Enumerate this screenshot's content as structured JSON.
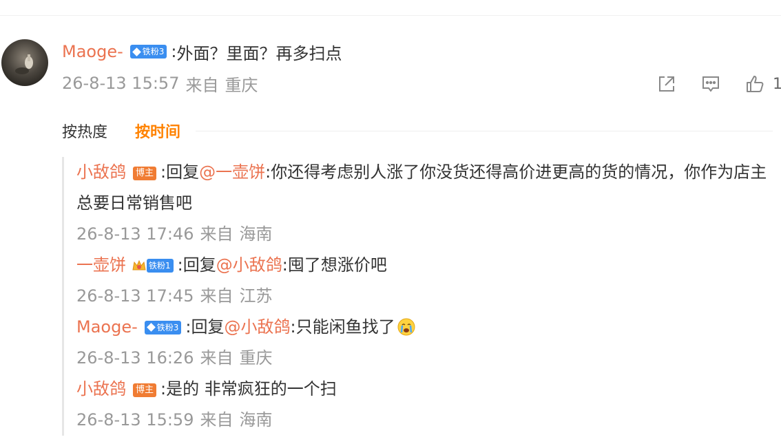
{
  "comment": {
    "username": "Maoge-",
    "fan_badge": "铁粉3",
    "text": "外面？里面？再多扫点",
    "date": "26-8-13 15:57",
    "from": "来自",
    "location": "重庆",
    "like_count": "1"
  },
  "sort": {
    "heat": "按热度",
    "time": "按时间"
  },
  "replies": [
    {
      "username": "小敌鸽",
      "badge": "博主",
      "reply_prefix": "回复",
      "mention": "@一壶饼",
      "text": "你还得考虑别人涨了你没货还得高价进更高的货的情况，你作为店主总要日常销售吧",
      "date": "26-8-13 17:46",
      "from": "来自",
      "location": "海南"
    },
    {
      "username": "一壶饼",
      "badge": "铁粉1",
      "reply_prefix": "回复",
      "mention": "@小敌鸽",
      "text": "囤了想涨价吧",
      "date": "26-8-13 17:45",
      "from": "来自",
      "location": "江苏"
    },
    {
      "username": "Maoge-",
      "badge": "铁粉3",
      "reply_prefix": "回复",
      "mention": "@小敌鸽",
      "text": "只能闲鱼找了",
      "date": "26-8-13 16:26",
      "from": "来自",
      "location": "重庆"
    },
    {
      "username": "小敌鸽",
      "badge": "博主",
      "text": "是的 非常疯狂的一个扫",
      "date": "26-8-13 15:59",
      "from": "来自",
      "location": "海南"
    }
  ],
  "colors": {
    "username": "#eb7350",
    "sort_active": "#ff8200",
    "fan_badge": "#3a8ef0",
    "host_badge": "#f07c33",
    "meta_text": "#999999"
  },
  "icons": [
    "share-icon",
    "comment-icon",
    "like-icon",
    "diamond-icon",
    "crown-icon",
    "crying-emoji-icon"
  ]
}
